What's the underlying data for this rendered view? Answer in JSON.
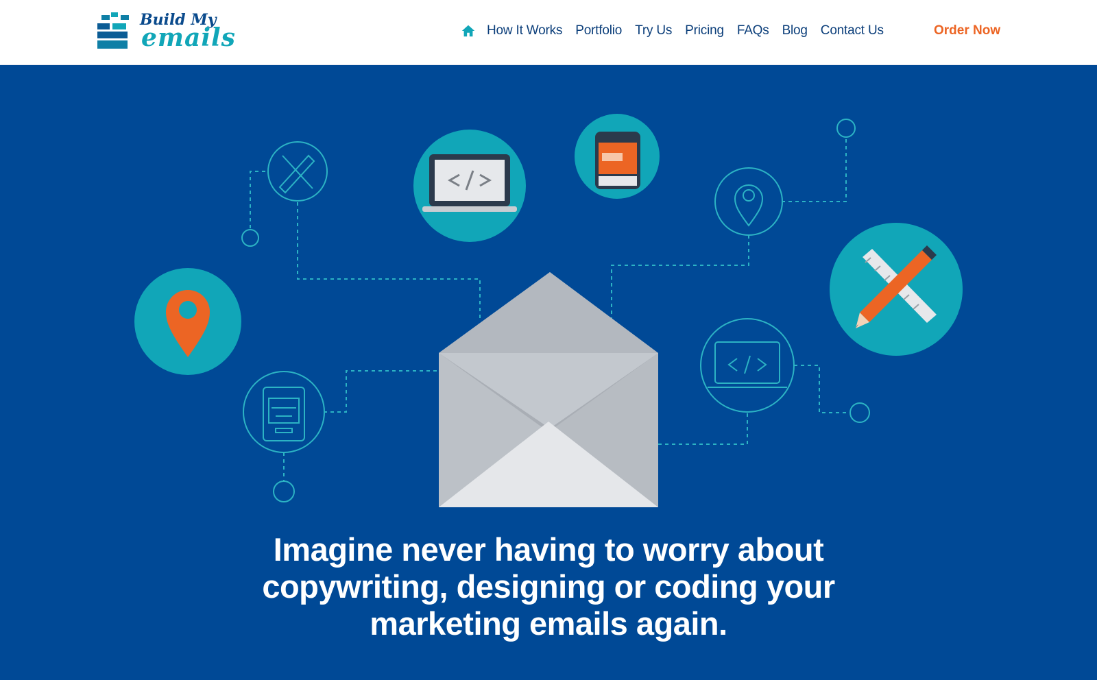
{
  "header": {
    "logo": {
      "line1": "Build My",
      "line2": "emails"
    },
    "nav": {
      "home_icon": "home-icon",
      "items": [
        {
          "label": "How It Works"
        },
        {
          "label": "Portfolio"
        },
        {
          "label": "Try Us"
        },
        {
          "label": "Pricing"
        },
        {
          "label": "FAQs"
        },
        {
          "label": "Blog"
        },
        {
          "label": "Contact Us"
        }
      ]
    },
    "cta_label": "Order Now"
  },
  "hero": {
    "headline": "Imagine never having to worry about copywriting, designing or coding your marketing emails again.",
    "illustration_icons": [
      "envelope-icon",
      "laptop-code-icon",
      "phone-icon",
      "map-pin-icon",
      "pencil-ruler-icon"
    ]
  },
  "colors": {
    "brand_blue": "#004996",
    "nav_text": "#0b3e7a",
    "accent_teal": "#11a6b8",
    "accent_orange": "#ec6524",
    "envelope_gray": "#b7bcc2"
  }
}
